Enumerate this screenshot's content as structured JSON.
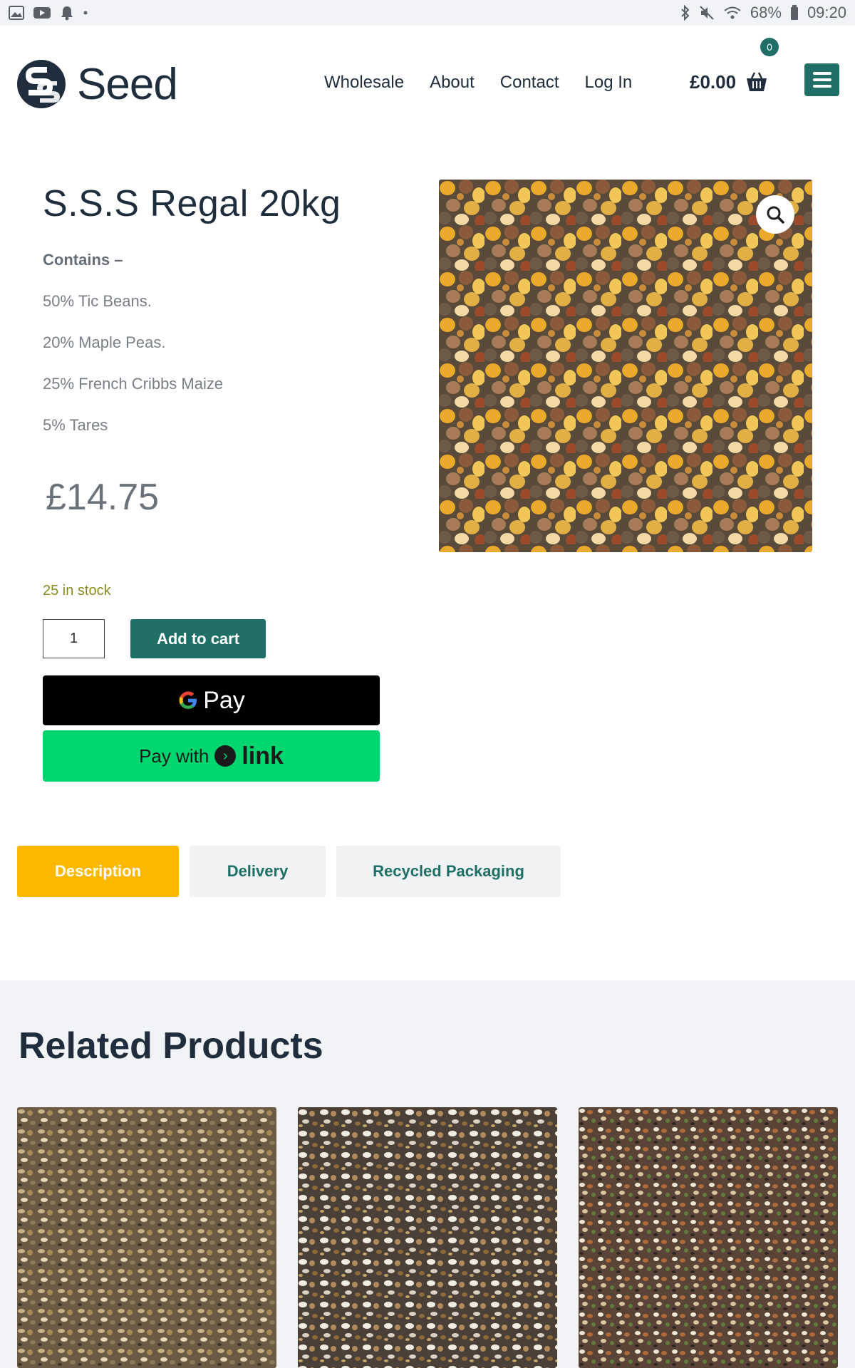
{
  "status_bar": {
    "battery": "68%",
    "time": "09:20",
    "left_icons": [
      "image-icon",
      "youtube-icon",
      "notification-bell-icon",
      "dot-icon"
    ],
    "right_icons": [
      "bluetooth-icon",
      "mute-icon",
      "wifi-icon",
      "battery-icon"
    ]
  },
  "header": {
    "logo_text": "Seed",
    "nav": [
      "Wholesale",
      "About",
      "Contact",
      "Log In"
    ],
    "cart_total": "£0.00",
    "cart_count": "0"
  },
  "product": {
    "title": "S.S.S Regal 20kg",
    "contains_label": "Contains –",
    "ingredients": [
      "50% Tic Beans.",
      "20% Maple Peas.",
      "25% French Cribbs Maize",
      "5% Tares"
    ],
    "price": "£14.75",
    "stock": "25 in stock",
    "quantity": "1",
    "add_to_cart": "Add to cart",
    "gpay_label": "Pay",
    "link_prefix": "Pay with",
    "link_brand": "link"
  },
  "tabs": [
    "Description",
    "Delivery",
    "Recycled Packaging"
  ],
  "related": {
    "title_light": "Related",
    "title_bold": "Products"
  },
  "colors": {
    "brand": "#1f6f66",
    "accent": "#fcb900",
    "link_green": "#00d66f",
    "stock": "#8a8a1e"
  }
}
